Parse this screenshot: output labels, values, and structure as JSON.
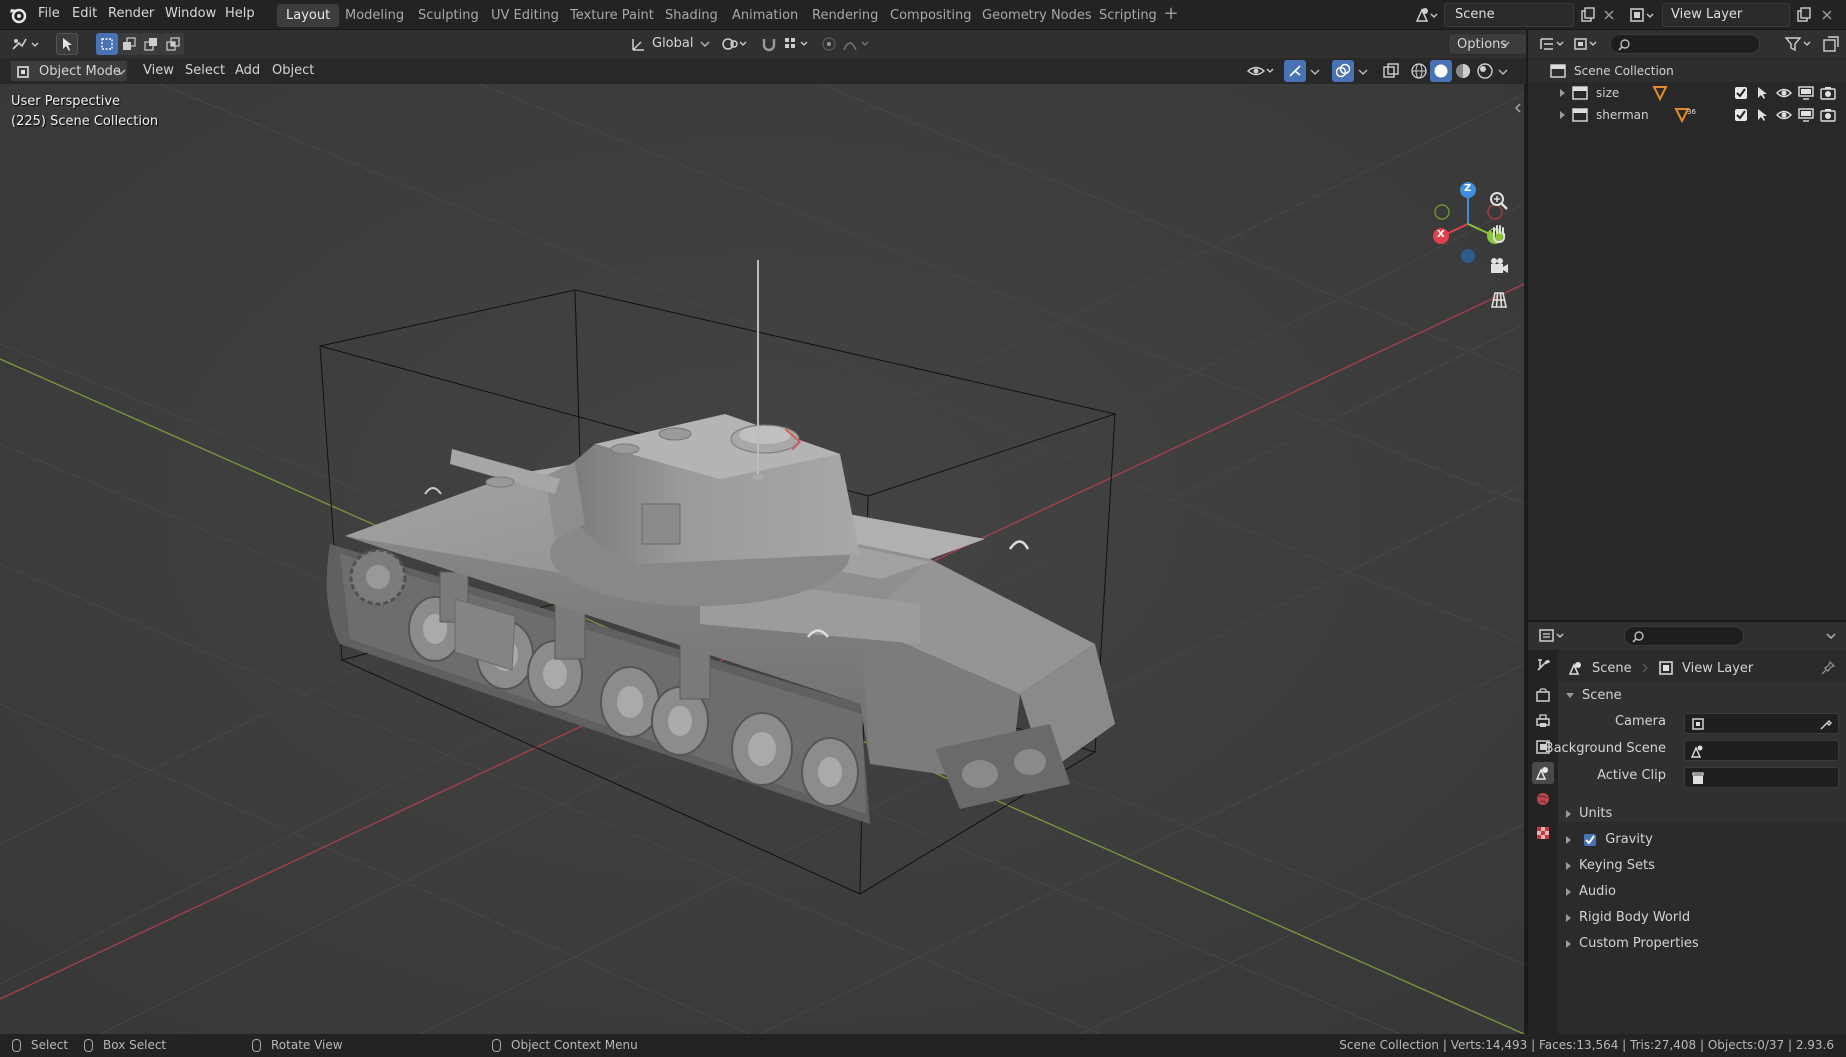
{
  "topbar": {
    "menus": [
      "File",
      "Edit",
      "Render",
      "Window",
      "Help"
    ],
    "workspaces": [
      "Layout",
      "Modeling",
      "Sculpting",
      "UV Editing",
      "Texture Paint",
      "Shading",
      "Animation",
      "Rendering",
      "Compositing",
      "Geometry Nodes",
      "Scripting"
    ],
    "active_workspace": "Layout",
    "scene": "Scene",
    "view_layer": "View Layer"
  },
  "viewport_header": {
    "transform_orientation": "Global",
    "options": "Options",
    "mode": "Object Mode",
    "menus": [
      "View",
      "Select",
      "Add",
      "Object"
    ]
  },
  "viewport": {
    "perspective": "User Perspective",
    "collection": "(225) Scene Collection",
    "gizmo_axes": [
      "X",
      "Y",
      "Z"
    ]
  },
  "outliner": {
    "root": "Scene Collection",
    "items": [
      {
        "name": "size"
      },
      {
        "name": "sherman",
        "badge": "36"
      }
    ]
  },
  "properties": {
    "breadcrumb_scene": "Scene",
    "breadcrumb_view_layer": "View Layer",
    "panel_title": "Scene",
    "fields": [
      {
        "label": "Camera"
      },
      {
        "label": "Background Scene"
      },
      {
        "label": "Active Clip"
      }
    ],
    "sections": [
      "Units",
      "Gravity",
      "Keying Sets",
      "Audio",
      "Rigid Body World",
      "Custom Properties"
    ],
    "gravity_checked": true
  },
  "status": {
    "select": "Select",
    "box_select": "Box Select",
    "rotate_view": "Rotate View",
    "context_menu": "Object Context Menu",
    "stats": "Scene Collection | Verts:14,493 | Faces:13,564 | Tris:27,408 | Objects:0/37 | 2.93.6"
  },
  "colors": {
    "accent": "#4772b3",
    "axis_x": "#e0414f",
    "axis_y": "#8bc43a",
    "axis_z": "#3e8ede",
    "viewport_bg": "#3d3d3d"
  }
}
